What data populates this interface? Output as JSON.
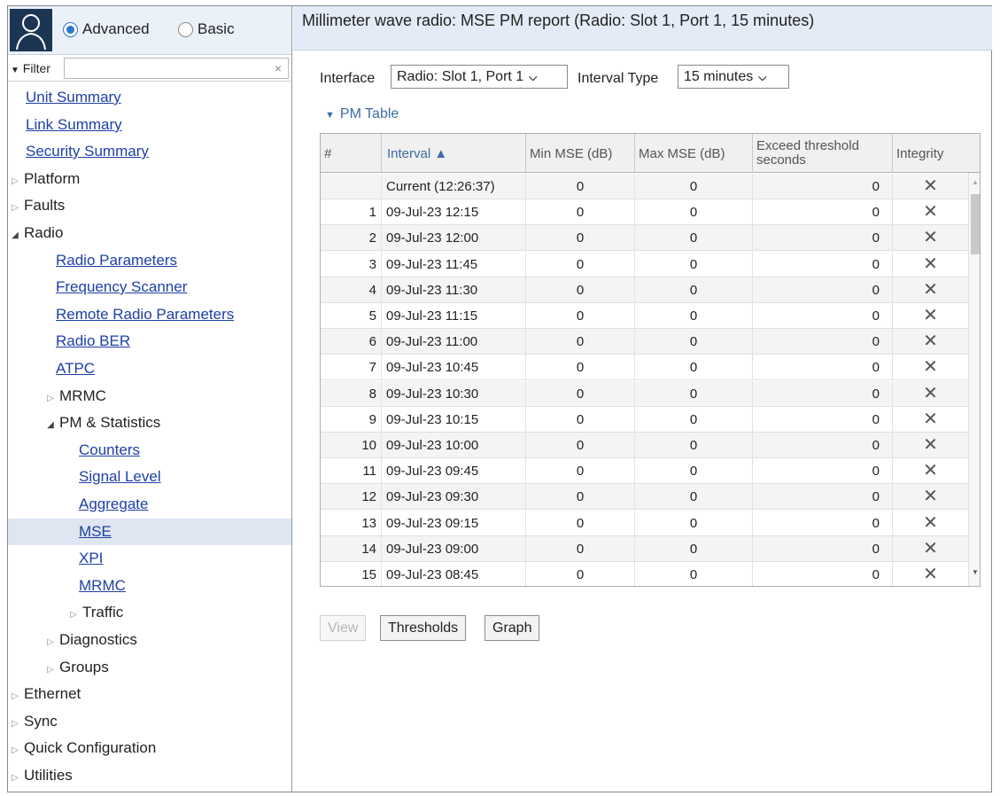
{
  "sidebar": {
    "mode_advanced": "Advanced",
    "mode_basic": "Basic",
    "filter_label": "Filter",
    "filter_value": "",
    "filter_clear": "×",
    "nav": [
      {
        "label": "Unit Summary",
        "type": "link",
        "level": 0
      },
      {
        "label": "Link Summary",
        "type": "link",
        "level": 0
      },
      {
        "label": "Security Summary",
        "type": "link",
        "level": 0
      },
      {
        "label": "Platform",
        "type": "folder",
        "open": false,
        "level": 0
      },
      {
        "label": "Faults",
        "type": "folder",
        "open": false,
        "level": 0
      },
      {
        "label": "Radio",
        "type": "folder",
        "open": true,
        "level": 0
      },
      {
        "label": "Radio Parameters",
        "type": "link",
        "level": 1
      },
      {
        "label": "Frequency Scanner",
        "type": "link",
        "level": 1
      },
      {
        "label": "Remote Radio Parameters",
        "type": "link",
        "level": 1
      },
      {
        "label": "Radio BER",
        "type": "link",
        "level": 1
      },
      {
        "label": "ATPC",
        "type": "link",
        "level": 1
      },
      {
        "label": "MRMC",
        "type": "folder",
        "open": false,
        "level": 1
      },
      {
        "label": "PM & Statistics",
        "type": "folder",
        "open": true,
        "level": 1
      },
      {
        "label": "Counters",
        "type": "link",
        "level": 2
      },
      {
        "label": "Signal Level",
        "type": "link",
        "level": 2
      },
      {
        "label": "Aggregate",
        "type": "link",
        "level": 2
      },
      {
        "label": "MSE",
        "type": "link",
        "level": 2,
        "selected": true
      },
      {
        "label": "XPI",
        "type": "link",
        "level": 2
      },
      {
        "label": "MRMC",
        "type": "link",
        "level": 2
      },
      {
        "label": "Traffic",
        "type": "folder",
        "open": false,
        "level": 2
      },
      {
        "label": "Diagnostics",
        "type": "folder",
        "open": false,
        "level": 1
      },
      {
        "label": "Groups",
        "type": "folder",
        "open": false,
        "level": 1
      },
      {
        "label": "Ethernet",
        "type": "folder",
        "open": false,
        "level": 0
      },
      {
        "label": "Sync",
        "type": "folder",
        "open": false,
        "level": 0
      },
      {
        "label": "Quick Configuration",
        "type": "folder",
        "open": false,
        "level": 0
      },
      {
        "label": "Utilities",
        "type": "folder",
        "open": false,
        "level": 0
      }
    ]
  },
  "main": {
    "title": "Millimeter wave radio: MSE PM report (Radio: Slot 1, Port 1, 15 minutes)",
    "interface_label": "Interface",
    "interface_value": "Radio: Slot 1, Port 1",
    "interval_type_label": "Interval Type",
    "interval_type_value": "15 minutes",
    "pm_table_title": "PM Table",
    "columns": {
      "num": "#",
      "interval": "Interval ▲",
      "min_mse": "Min MSE (dB)",
      "max_mse": "Max MSE (dB)",
      "exceed_line1": "Exceed threshold",
      "exceed_line2": "seconds",
      "integrity": "Integrity"
    },
    "rows": [
      {
        "num": "",
        "interval": "Current (12:26:37)",
        "min": "0",
        "max": "0",
        "exceed": "0",
        "integrity": "✕"
      },
      {
        "num": "1",
        "interval": "09-Jul-23 12:15",
        "min": "0",
        "max": "0",
        "exceed": "0",
        "integrity": "✕"
      },
      {
        "num": "2",
        "interval": "09-Jul-23 12:00",
        "min": "0",
        "max": "0",
        "exceed": "0",
        "integrity": "✕"
      },
      {
        "num": "3",
        "interval": "09-Jul-23 11:45",
        "min": "0",
        "max": "0",
        "exceed": "0",
        "integrity": "✕"
      },
      {
        "num": "4",
        "interval": "09-Jul-23 11:30",
        "min": "0",
        "max": "0",
        "exceed": "0",
        "integrity": "✕"
      },
      {
        "num": "5",
        "interval": "09-Jul-23 11:15",
        "min": "0",
        "max": "0",
        "exceed": "0",
        "integrity": "✕"
      },
      {
        "num": "6",
        "interval": "09-Jul-23 11:00",
        "min": "0",
        "max": "0",
        "exceed": "0",
        "integrity": "✕"
      },
      {
        "num": "7",
        "interval": "09-Jul-23 10:45",
        "min": "0",
        "max": "0",
        "exceed": "0",
        "integrity": "✕"
      },
      {
        "num": "8",
        "interval": "09-Jul-23 10:30",
        "min": "0",
        "max": "0",
        "exceed": "0",
        "integrity": "✕"
      },
      {
        "num": "9",
        "interval": "09-Jul-23 10:15",
        "min": "0",
        "max": "0",
        "exceed": "0",
        "integrity": "✕"
      },
      {
        "num": "10",
        "interval": "09-Jul-23 10:00",
        "min": "0",
        "max": "0",
        "exceed": "0",
        "integrity": "✕"
      },
      {
        "num": "11",
        "interval": "09-Jul-23 09:45",
        "min": "0",
        "max": "0",
        "exceed": "0",
        "integrity": "✕"
      },
      {
        "num": "12",
        "interval": "09-Jul-23 09:30",
        "min": "0",
        "max": "0",
        "exceed": "0",
        "integrity": "✕"
      },
      {
        "num": "13",
        "interval": "09-Jul-23 09:15",
        "min": "0",
        "max": "0",
        "exceed": "0",
        "integrity": "✕"
      },
      {
        "num": "14",
        "interval": "09-Jul-23 09:00",
        "min": "0",
        "max": "0",
        "exceed": "0",
        "integrity": "✕"
      },
      {
        "num": "15",
        "interval": "09-Jul-23 08:45",
        "min": "0",
        "max": "0",
        "exceed": "0",
        "integrity": "✕"
      }
    ],
    "buttons": {
      "view": "View",
      "thresholds": "Thresholds",
      "graph": "Graph"
    }
  }
}
